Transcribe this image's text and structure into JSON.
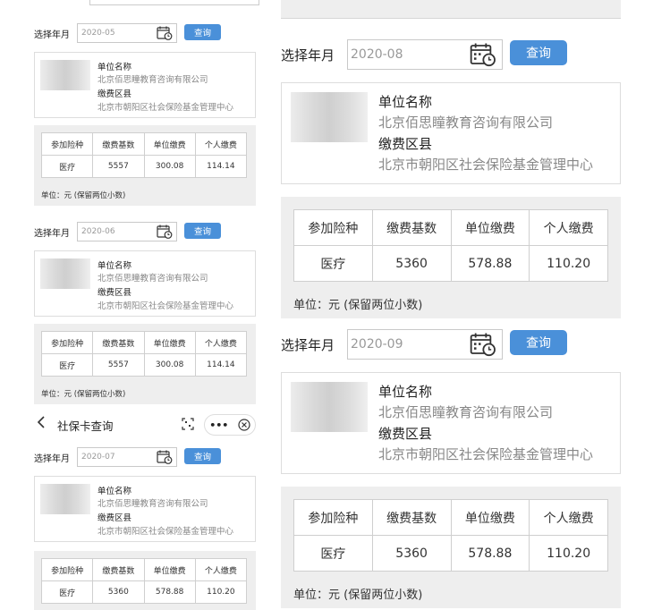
{
  "common": {
    "select_label": "选择年月",
    "query_label": "查询",
    "unit_name_label": "单位名称",
    "unit_name_value": "北京佰思瞳教育咨询有限公司",
    "district_label": "缴费区县",
    "district_value": "北京市朝阳区社会保险基金管理中心",
    "headers": [
      "参加险种",
      "缴费基数",
      "单位缴费",
      "个人缴费"
    ],
    "unit_note": "单位：元 (保留两位小数)"
  },
  "nav": {
    "back_icon": "chevron-left-icon",
    "title": "社保卡查询",
    "more": "•••"
  },
  "records": [
    {
      "month": "2020-05",
      "row": [
        "医疗",
        "5557",
        "300.08",
        "114.14"
      ]
    },
    {
      "month": "2020-06",
      "row": [
        "医疗",
        "5557",
        "300.08",
        "114.14"
      ]
    },
    {
      "month": "2020-07",
      "row": [
        "医疗",
        "5360",
        "578.88",
        "110.20"
      ]
    },
    {
      "month": "2020-08",
      "row": [
        "医疗",
        "5360",
        "578.88",
        "110.20"
      ]
    },
    {
      "month": "2020-09",
      "row": [
        "医疗",
        "5360",
        "578.88",
        "110.20"
      ]
    }
  ],
  "colors": {
    "accent": "#4a90d9",
    "panel": "#eeeeee",
    "border": "#cfcfcf"
  }
}
